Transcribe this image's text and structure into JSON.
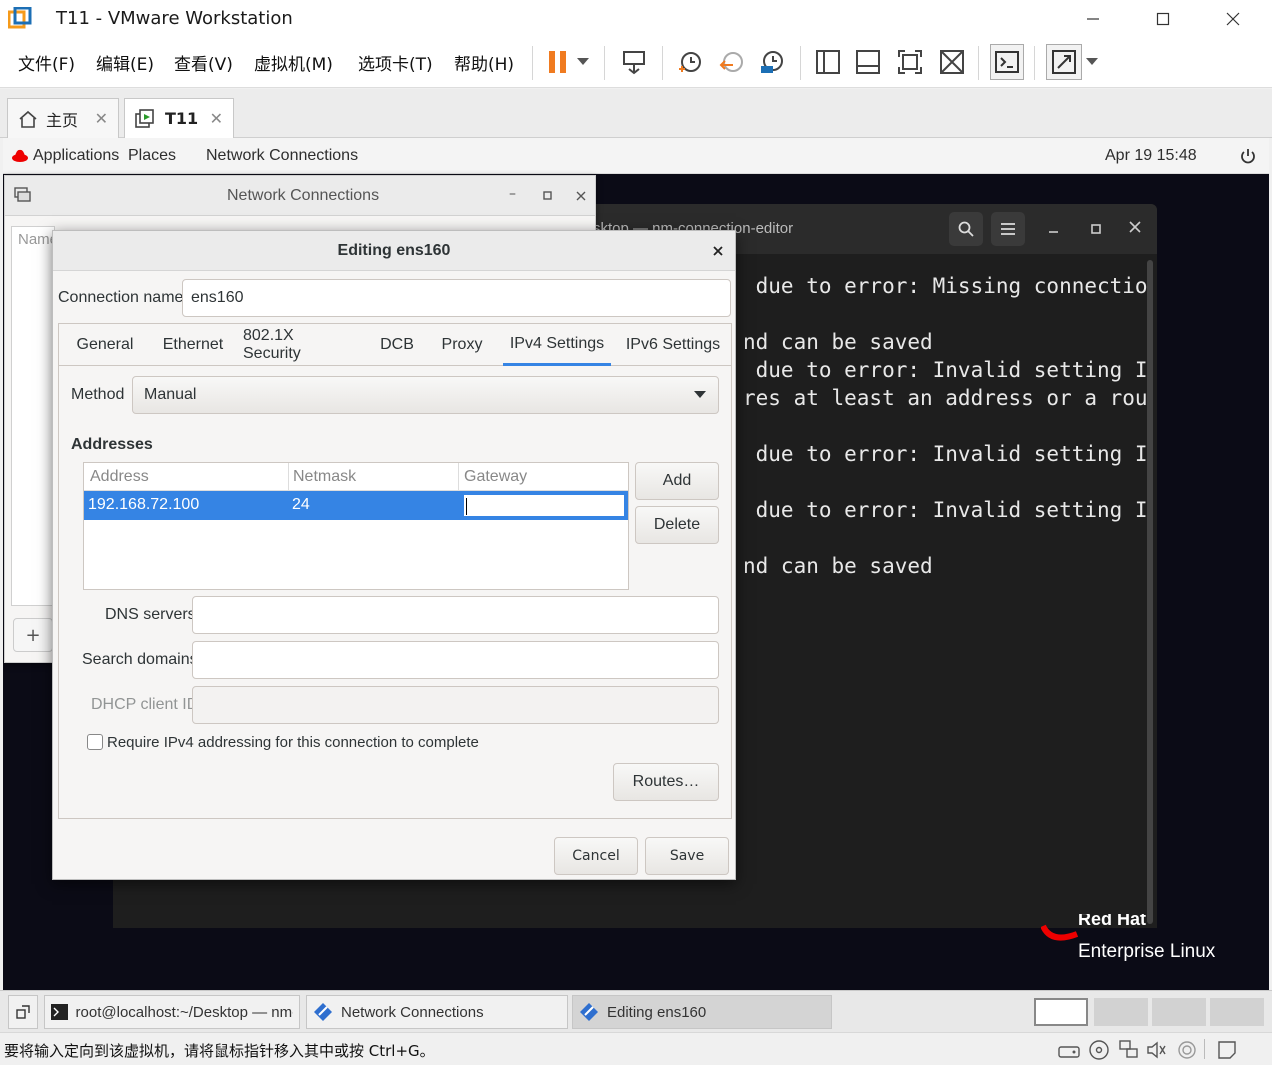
{
  "window": {
    "title": "T11 - VMware Workstation"
  },
  "menu": [
    "文件(F)",
    "编辑(E)",
    "查看(V)",
    "虚拟机(M)",
    "选项卡(T)",
    "帮助(H)"
  ],
  "tabs": [
    {
      "label": "主页"
    },
    {
      "label": "T11"
    }
  ],
  "gnome": {
    "applications": "Applications",
    "places": "Places",
    "app_menu": "Network Connections",
    "clock": "Apr 19  15:48"
  },
  "terminal": {
    "title": "sktop — nm-connection-editor",
    "lines": [
      " due to error: Missing connectio",
      "",
      "nd can be saved",
      " due to error: Invalid setting I",
      "res at least an address or a rou",
      "",
      " due to error: Invalid setting I",
      "",
      " due to error: Invalid setting I",
      "",
      "nd can be saved"
    ]
  },
  "nc": {
    "title": "Network Connections",
    "col_name": "Name",
    "add": "+"
  },
  "editor": {
    "title": "Editing ens160",
    "connection_label": "Connection name",
    "connection_value": "ens160",
    "tabs": [
      "General",
      "Ethernet",
      "802.1X Security",
      "DCB",
      "Proxy",
      "IPv4 Settings",
      "IPv6 Settings"
    ],
    "method_label": "Method",
    "method_value": "Manual",
    "addresses_label": "Addresses",
    "columns": [
      "Address",
      "Netmask",
      "Gateway"
    ],
    "row": {
      "address": "192.168.72.100",
      "netmask": "24",
      "gateway": ""
    },
    "add": "Add",
    "delete": "Delete",
    "dns_label": "DNS servers",
    "search_label": "Search domains",
    "dhcp_label": "DHCP client ID",
    "require_label": "Require IPv4 addressing for this connection to complete",
    "routes": "Routes…",
    "cancel": "Cancel",
    "save": "Save"
  },
  "redhat": {
    "line1": "Red Hat",
    "line2": "Enterprise Linux"
  },
  "taskbar": [
    {
      "label": "root@localhost:~/Desktop — nm-…"
    },
    {
      "label": "Network Connections"
    },
    {
      "label": "Editing ens160"
    }
  ],
  "status": {
    "message": "要将输入定向到该虚拟机，请将鼠标指针移入其中或按 Ctrl+G。"
  },
  "colors": {
    "accent": "#3584e4",
    "pause": "#f07b20",
    "vmware": "#f59a1a"
  }
}
